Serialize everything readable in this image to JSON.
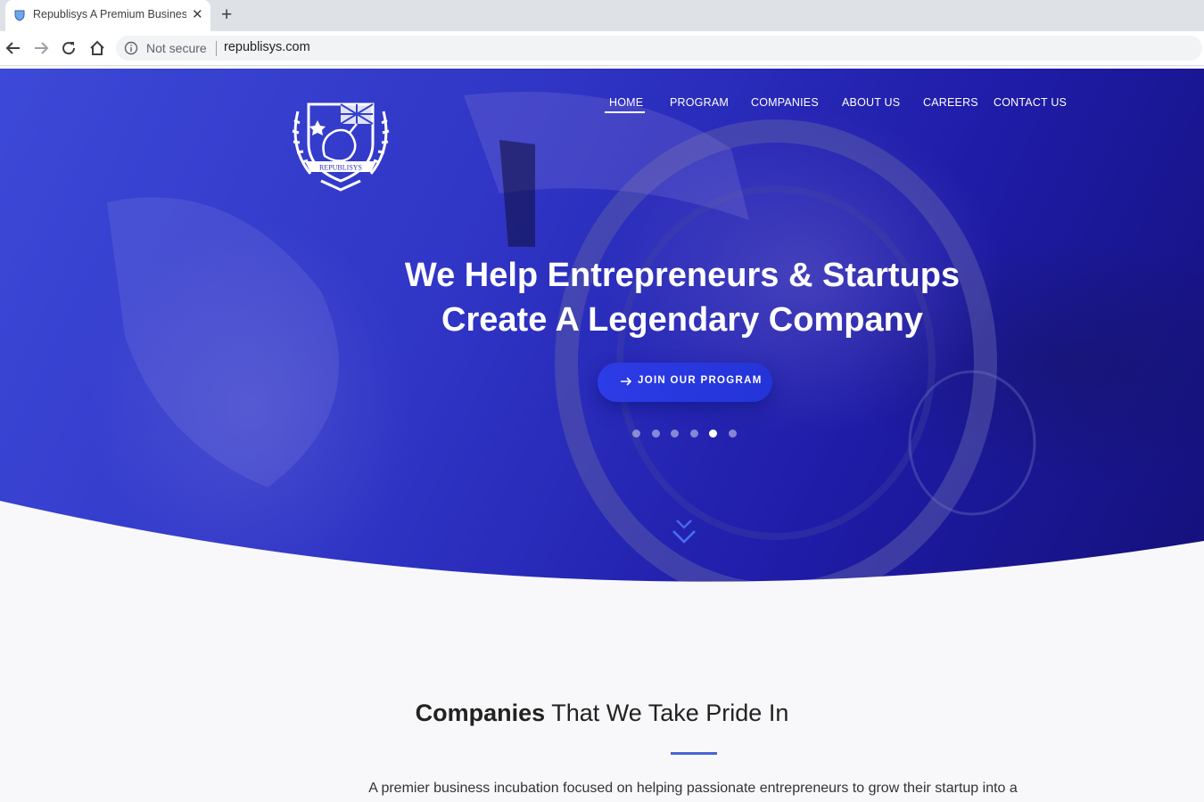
{
  "browser": {
    "tab_title": "Republisys A Premium Business",
    "new_tab_symbol": "+",
    "close_symbol": "✕",
    "security_label": "Not secure",
    "url": "republisys.com"
  },
  "nav": {
    "items": [
      {
        "label": "HOME",
        "active": true
      },
      {
        "label": "PROGRAM"
      },
      {
        "label": "COMPANIES"
      },
      {
        "label": "ABOUT US"
      },
      {
        "label": "CAREERS"
      },
      {
        "label": "CONTACT US"
      }
    ]
  },
  "logo": {
    "text": "REPUBLISYS"
  },
  "hero": {
    "headline_line1": "We Help Entrepreneurs & Startups",
    "headline_line2": "Create A Legendary Company",
    "cta_label": "JOIN OUR PROGRAM",
    "slides_total": 6,
    "slide_active": 5
  },
  "section": {
    "title_bold": "Companies",
    "title_rest": " That We Take Pride In",
    "text": "A premier business incubation focused on helping passionate entrepreneurs to grow their startup into a"
  },
  "colors": {
    "hero_primary": "#2f34c4",
    "hero_dark": "#14107a",
    "accent_rule": "#4a63d4",
    "page_bg": "#f8f8fa"
  }
}
